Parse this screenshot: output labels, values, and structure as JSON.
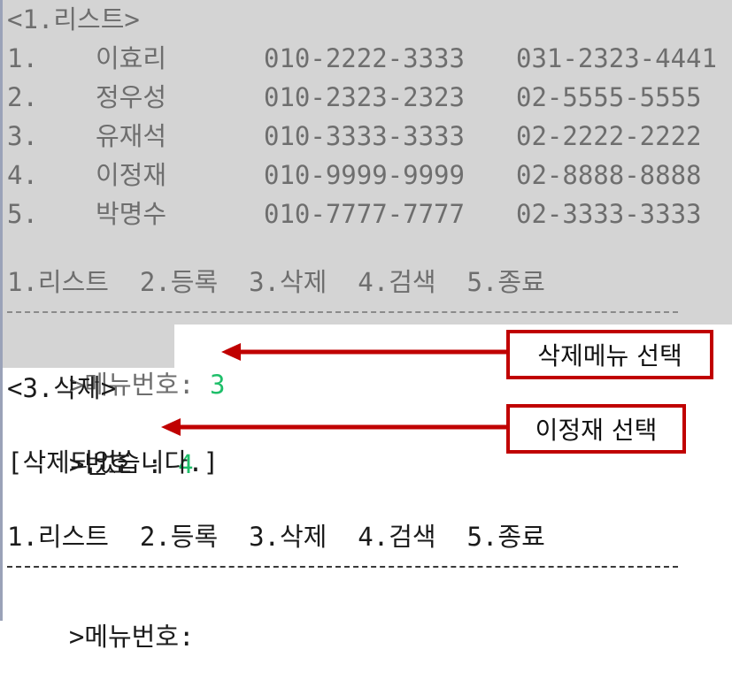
{
  "list_section": {
    "title": "<1.리스트>",
    "rows": [
      {
        "num": "1.",
        "name": "이효리",
        "mobile": "010-2222-3333",
        "home": "031-2323-4441"
      },
      {
        "num": "2.",
        "name": "정우성",
        "mobile": "010-2323-2323",
        "home": "02-5555-5555"
      },
      {
        "num": "3.",
        "name": "유재석",
        "mobile": "010-3333-3333",
        "home": "02-2222-2222"
      },
      {
        "num": "4.",
        "name": "이정재",
        "mobile": "010-9999-9999",
        "home": "02-8888-8888"
      },
      {
        "num": "5.",
        "name": "박명수",
        "mobile": "010-7777-7777",
        "home": "02-3333-3333"
      }
    ]
  },
  "menu_bar_text": "1.리스트  2.등록  3.삭제  4.검색  5.종료",
  "prompt_label": ">메뉴번호:",
  "prompt_input_1": "3",
  "delete_section_title": "<3.삭제>",
  "number_prompt_label": ">번호 :",
  "number_prompt_input": "4",
  "deleted_message": "[삭제되었습니다.]",
  "callouts": {
    "delete_menu": "삭제메뉴 선택",
    "select_person": "이정재 선택"
  },
  "colors": {
    "input_green": "#1fbf6a",
    "callout_red": "#c00000",
    "previous_output_grey": "#d4d4d4"
  }
}
